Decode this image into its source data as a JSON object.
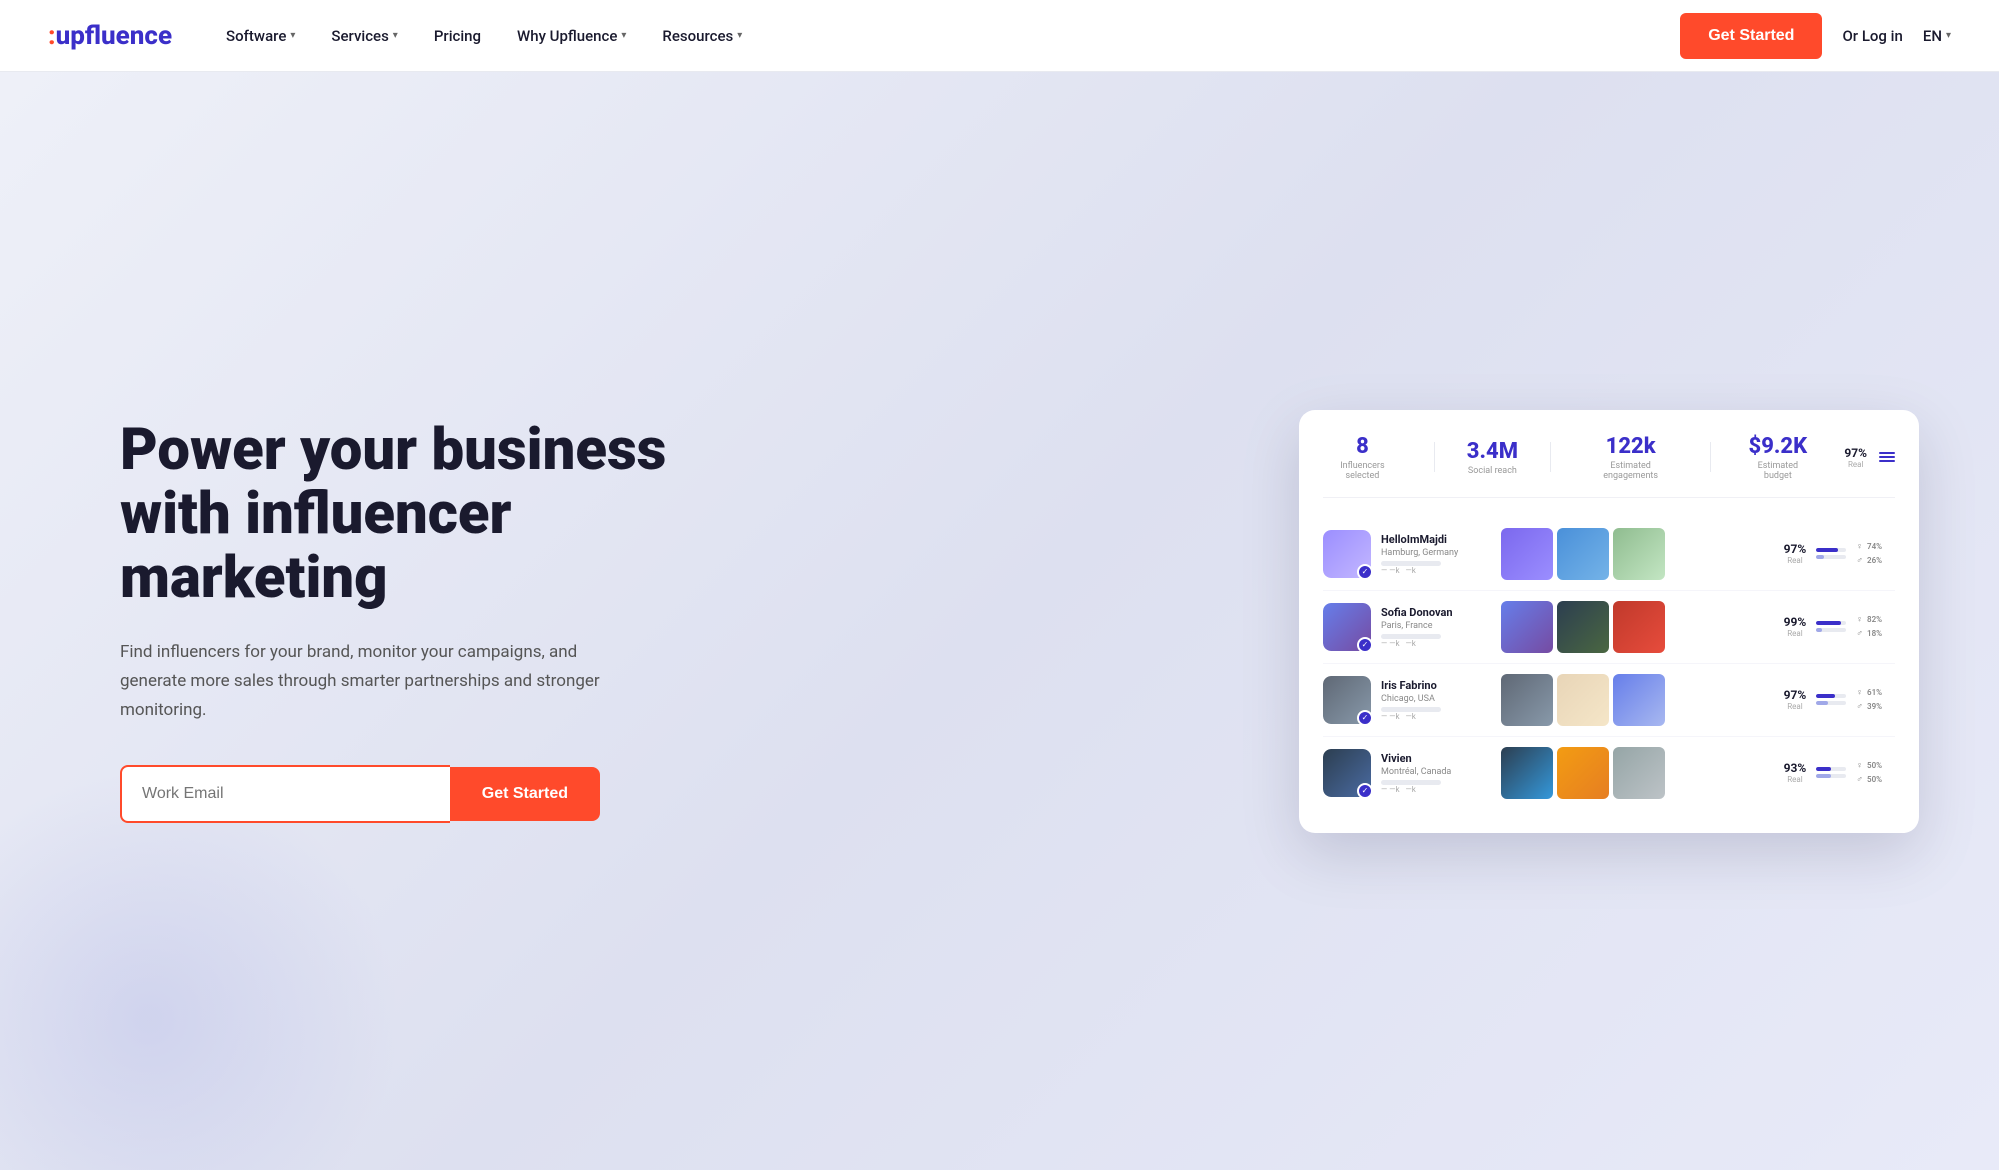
{
  "nav": {
    "logo": "upfluence",
    "logo_prefix": ":",
    "items": [
      {
        "label": "Software",
        "has_dropdown": true
      },
      {
        "label": "Services",
        "has_dropdown": true
      },
      {
        "label": "Pricing",
        "has_dropdown": false
      },
      {
        "label": "Why Upfluence",
        "has_dropdown": true
      },
      {
        "label": "Resources",
        "has_dropdown": true
      }
    ],
    "cta_label": "Get Started",
    "login_label": "Or Log in",
    "lang_label": "EN"
  },
  "hero": {
    "title": "Power your business with influencer marketing",
    "subtitle": "Find influencers for your brand, monitor your campaigns, and generate more sales through smarter partnerships and stronger monitoring.",
    "email_placeholder": "Work Email",
    "cta_label": "Get Started"
  },
  "dashboard": {
    "stats": [
      {
        "value": "8",
        "label": "Influencers selected"
      },
      {
        "value": "3.4M",
        "label": "Social reach"
      },
      {
        "value": "122k",
        "label": "Estimated engagements"
      },
      {
        "value": "$9.2K",
        "label": "Estimated budget"
      }
    ],
    "right_stat": {
      "value": "97%",
      "label": "Real"
    },
    "influencers": [
      {
        "name": "HelloImMajdi",
        "location": "Hamburg, Germany",
        "real_pct": "97%",
        "real_label": "Real",
        "female_pct": "74%",
        "male_pct": "26%",
        "female_bar": 74,
        "male_bar": 26,
        "avatar_class": "av-1",
        "thumbs": [
          "thumb-1a",
          "thumb-1b",
          "thumb-1c"
        ]
      },
      {
        "name": "Sofia Donovan",
        "location": "Paris, France",
        "real_pct": "99%",
        "real_label": "Real",
        "female_pct": "82%",
        "male_pct": "18%",
        "female_bar": 82,
        "male_bar": 18,
        "avatar_class": "av-2",
        "thumbs": [
          "thumb-2a",
          "thumb-2b",
          "thumb-2c"
        ]
      },
      {
        "name": "Iris Fabrino",
        "location": "Chicago, USA",
        "real_pct": "97%",
        "real_label": "Real",
        "female_pct": "61%",
        "male_pct": "39%",
        "female_bar": 61,
        "male_bar": 39,
        "avatar_class": "av-3",
        "thumbs": [
          "thumb-3a",
          "thumb-3b",
          "thumb-3c"
        ]
      },
      {
        "name": "Vivien",
        "location": "Montréal, Canada",
        "real_pct": "93%",
        "real_label": "Real",
        "female_pct": "50%",
        "male_pct": "50%",
        "female_bar": 50,
        "male_bar": 50,
        "avatar_class": "av-4",
        "thumbs": [
          "thumb-4a",
          "thumb-4b",
          "thumb-4c"
        ]
      }
    ]
  }
}
